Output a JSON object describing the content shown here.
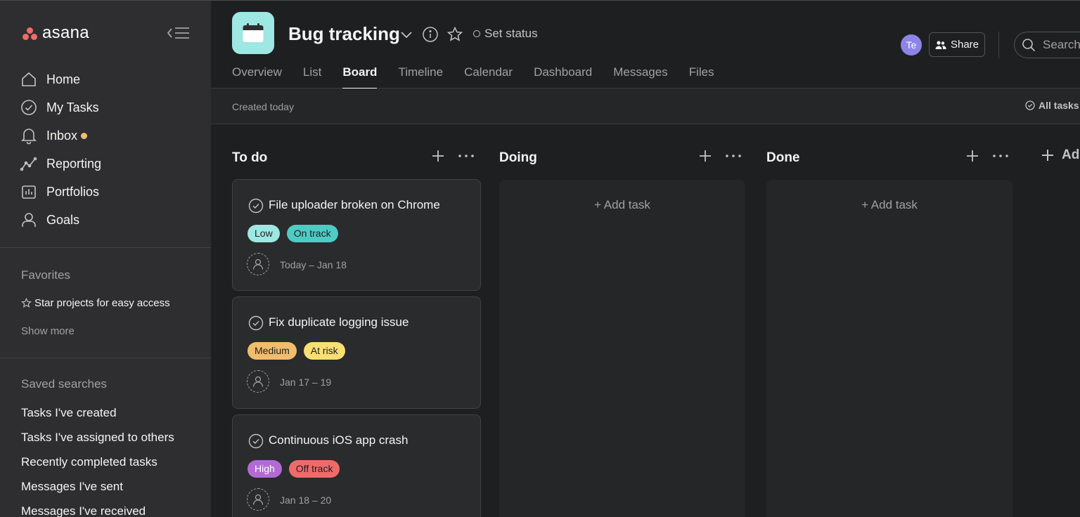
{
  "sidebar": {
    "logo_text": "asana",
    "nav": [
      {
        "label": "Home",
        "icon": "home-icon"
      },
      {
        "label": "My Tasks",
        "icon": "check-circle-icon"
      },
      {
        "label": "Inbox",
        "icon": "bell-icon",
        "unread_dot": true
      },
      {
        "label": "Reporting",
        "icon": "reporting-icon"
      },
      {
        "label": "Portfolios",
        "icon": "portfolio-icon"
      },
      {
        "label": "Goals",
        "icon": "goals-icon"
      }
    ],
    "favorites": {
      "title": "Favorites",
      "hint": "Star projects for easy access",
      "show_more": "Show more"
    },
    "saved_searches": {
      "title": "Saved searches",
      "items": [
        "Tasks I've created",
        "Tasks I've assigned to others",
        "Recently completed tasks",
        "Messages I've sent",
        "Messages I've received"
      ]
    }
  },
  "header": {
    "project_title": "Bug tracking",
    "set_status": "Set status",
    "avatar_initials": "Te",
    "share_label": "Share",
    "search_placeholder": "Search",
    "tabs": [
      "Overview",
      "List",
      "Board",
      "Timeline",
      "Calendar",
      "Dashboard",
      "Messages",
      "Files"
    ],
    "active_tab": "Board"
  },
  "subbar": {
    "created": "Created today",
    "all_tasks": "All tasks"
  },
  "board": {
    "columns": [
      {
        "title": "To do"
      },
      {
        "title": "Doing",
        "add_task": "+ Add task"
      },
      {
        "title": "Done",
        "add_task": "+ Add task"
      }
    ],
    "add_section": "Ad",
    "cards": [
      {
        "title": "File uploader broken on Chrome",
        "priority": "Low",
        "status": "On track",
        "due": "Today – Jan 18"
      },
      {
        "title": "Fix duplicate logging issue",
        "priority": "Medium",
        "status": "At risk",
        "due": "Jan 17 – 19"
      },
      {
        "title": "Continuous iOS app crash",
        "priority": "High",
        "status": "Off track",
        "due": "Jan 18 – 20"
      }
    ]
  },
  "colors": {
    "accent_logo": "#f06a6a",
    "inbox_dot": "#f1bd6c",
    "project_icon_bg": "#9ee7e3",
    "avatar_bg": "#8d84e8",
    "tag_low": "#9ee7e3",
    "tag_on_track": "#4ecbc4",
    "tag_medium": "#f1bd6c",
    "tag_at_risk": "#f8df72",
    "tag_high": "#b36bd4",
    "tag_off_track": "#f06a6a"
  }
}
